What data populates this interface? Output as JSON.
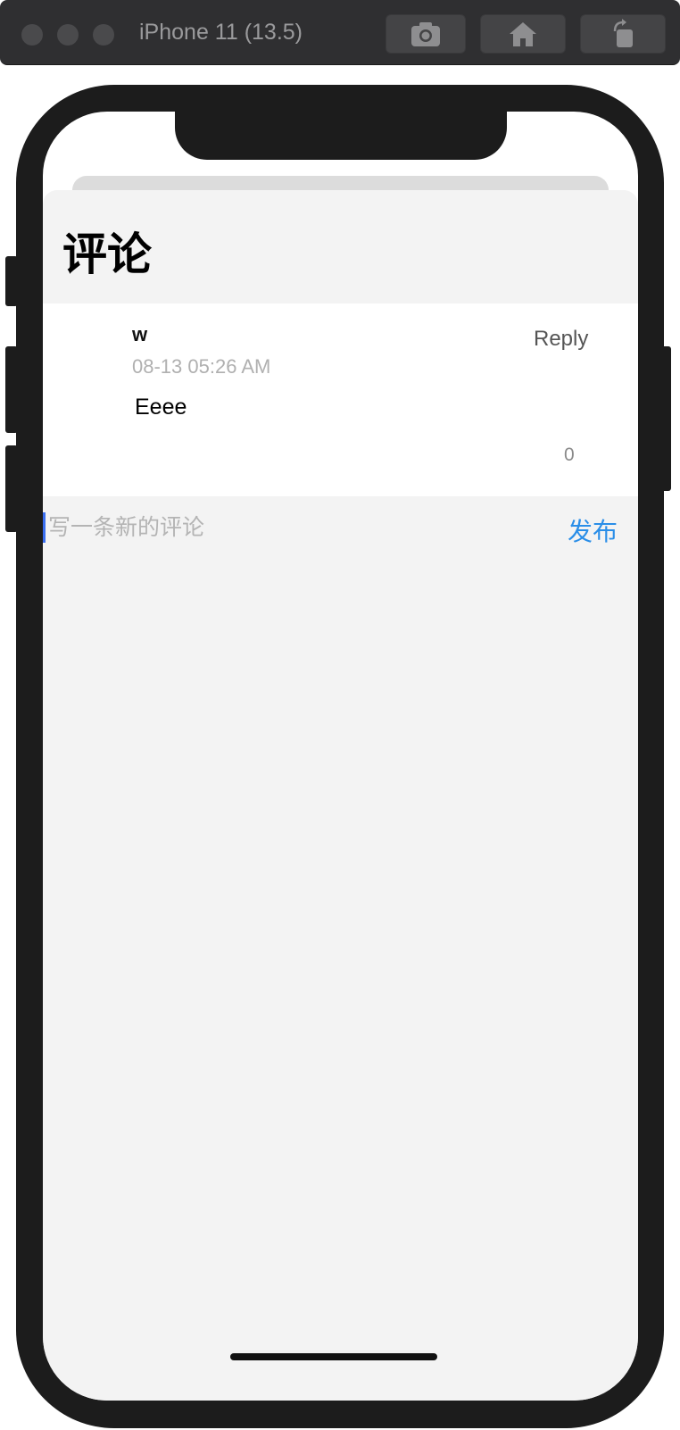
{
  "simulator": {
    "title": "iPhone 11 (13.5)",
    "toolbar": [
      "screenshot-icon",
      "home-icon",
      "rotate-icon"
    ]
  },
  "sheet": {
    "title": "评论"
  },
  "comments": [
    {
      "author": "w",
      "time": "08-13 05:26 AM",
      "body": "Eeee",
      "reply_label": "Reply",
      "likes": "0"
    }
  ],
  "composer": {
    "placeholder": "写一条新的评论",
    "value": "",
    "submit_label": "发布"
  },
  "colors": {
    "accent": "#2a8ee8",
    "caret": "#3a6ef0",
    "sheet_bg": "#f3f3f3",
    "card_bg": "#ffffff"
  }
}
